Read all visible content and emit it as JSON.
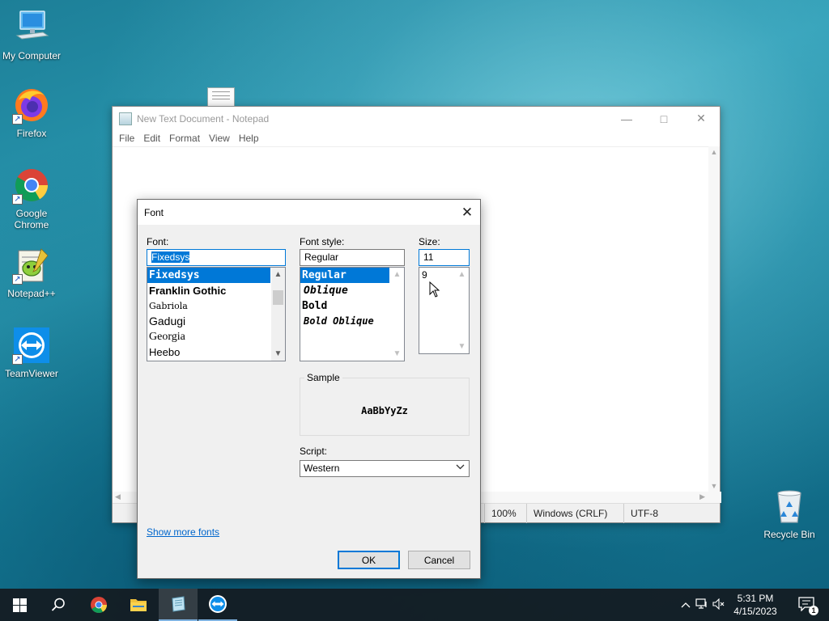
{
  "desktop": {
    "icons": [
      {
        "label": "My Computer"
      },
      {
        "label": "Firefox"
      },
      {
        "label": "Google Chrome"
      },
      {
        "label": "Notepad++"
      },
      {
        "label": "TeamViewer"
      },
      {
        "label": "Recycle Bin"
      }
    ]
  },
  "notepad": {
    "title": "New Text Document - Notepad",
    "menu": [
      "File",
      "Edit",
      "Format",
      "View",
      "Help"
    ],
    "status": {
      "zoom": "100%",
      "line_endings": "Windows (CRLF)",
      "encoding": "UTF-8"
    }
  },
  "font_dialog": {
    "title": "Font",
    "font_label": "Font:",
    "font_value": "Fixedsys",
    "fonts": [
      "Fixedsys",
      "Franklin Gothic",
      "Gabriola",
      "Gadugi",
      "Georgia",
      "Heebo"
    ],
    "style_label": "Font style:",
    "style_value": "Regular",
    "styles": [
      "Regular",
      "Oblique",
      "Bold",
      "Bold Oblique"
    ],
    "size_label": "Size:",
    "size_value": "11",
    "sizes": [
      "9"
    ],
    "sample_label": "Sample",
    "sample_text": "AaBbYyZz",
    "script_label": "Script:",
    "script_value": "Western",
    "show_more_fonts": "Show more fonts",
    "ok_label": "OK",
    "cancel_label": "Cancel"
  },
  "taskbar": {
    "time": "5:31 PM",
    "date": "4/15/2023",
    "notification_count": "1"
  },
  "colors": {
    "selection": "#0078d7",
    "taskbar": "#141c22",
    "dialog_bg": "#f0f0f0"
  }
}
